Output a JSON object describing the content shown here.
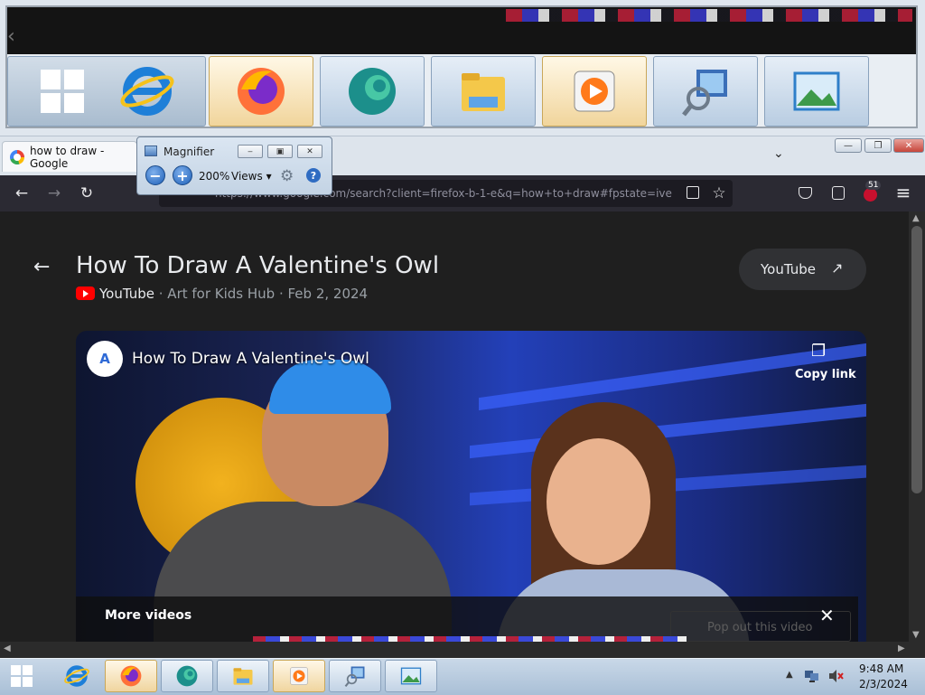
{
  "magnifier": {
    "title": "Magnifier",
    "zoom": "200%",
    "views_label": "Views",
    "minimize": "‒",
    "restore": "▣",
    "close": "✕"
  },
  "browser": {
    "tab_title": "how to draw - Google",
    "url": "https://www.google.com/search?client=firefox-b-1-e&q=how+to+draw#fpstate=ive",
    "extension_badge": "51"
  },
  "page": {
    "title": "How To Draw A Valentine's Owl",
    "source": "YouTube",
    "meta_rest": " · Art for Kids Hub · Feb 2, 2024",
    "open_button": "YouTube"
  },
  "player": {
    "title": "How To Draw A Valentine's Owl",
    "copy_link": "Copy link",
    "more_videos": "More videos",
    "popout": "Pop out this video"
  },
  "taskbar": {
    "time": "9:48 AM",
    "date": "2/3/2024"
  },
  "icons": {
    "back": "←",
    "forward": "→",
    "reload": "↻",
    "chevron_down": "⌄",
    "menu": "≡",
    "star": "☆",
    "external": "↗",
    "copy": "❐",
    "close": "✕",
    "gear": "⚙",
    "help": "?"
  },
  "colors": {
    "page_bg": "#1f1f1f",
    "nav_bg": "#2b2a33",
    "youtube_red": "#ff0000",
    "taskbar": "#b9cde2"
  }
}
